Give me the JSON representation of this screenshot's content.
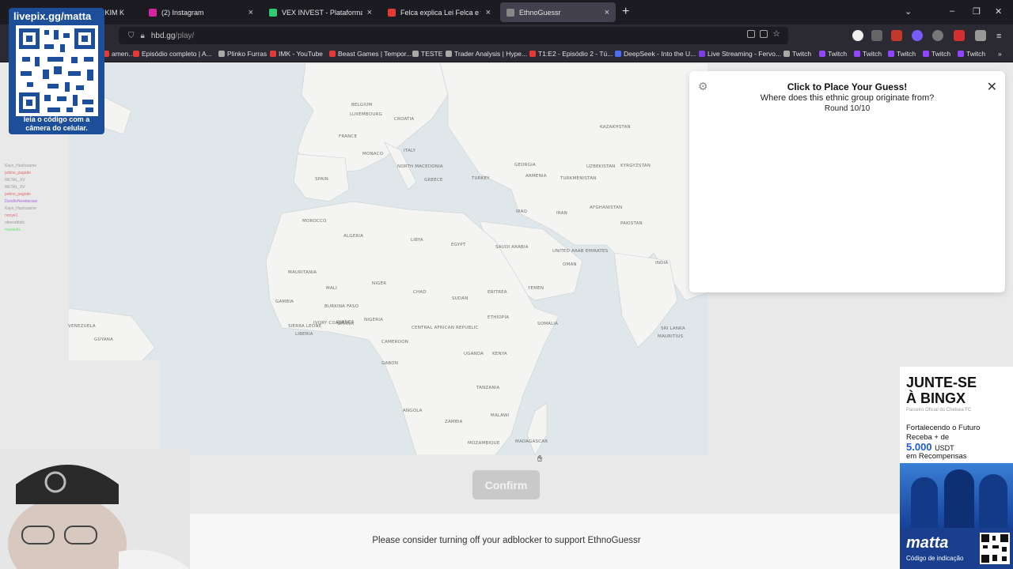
{
  "browser": {
    "tabs": [
      {
        "title": "E KIM K",
        "close": "×",
        "color": "#c0392b"
      },
      {
        "title": "(2) Instagram",
        "close": "×",
        "color": "#d6249f"
      },
      {
        "title": "VEX INVEST - Plataforma de Inv",
        "close": "×",
        "color": "#2ecc71"
      },
      {
        "title": "Felca explica Lei Felca e faz aler",
        "close": "×",
        "color": "#e53935"
      },
      {
        "title": "EthnoGuessr",
        "close": "×",
        "color": "#888888"
      }
    ],
    "new_tab": "+",
    "url_host": "hbd.gg",
    "url_path": "/play/",
    "bookmarks": [
      {
        "label": "amen...",
        "color": "#e53935"
      },
      {
        "label": "Episódio completo | A...",
        "color": "#e53935"
      },
      {
        "label": "Plinko Furras",
        "color": "#aaaaaa"
      },
      {
        "label": "IMK - YouTube",
        "color": "#e53935"
      },
      {
        "label": "Beast Games | Tempor...",
        "color": "#e53935"
      },
      {
        "label": "TESTE",
        "color": "#aaaaaa"
      },
      {
        "label": "Trader Analysis | Hype...",
        "color": "#aaaaaa"
      },
      {
        "label": "T1:E2 - Episódio 2 - Tú...",
        "color": "#e53935"
      },
      {
        "label": "DeepSeek - Into the U...",
        "color": "#4a6cf7"
      },
      {
        "label": "Live Streaming - Fervo...",
        "color": "#7b3fe4"
      },
      {
        "label": "Twitch",
        "color": "#aaaaaa"
      },
      {
        "label": "Twitch",
        "color": "#9146ff"
      },
      {
        "label": "Twitch",
        "color": "#9146ff"
      },
      {
        "label": "Twitch",
        "color": "#9146ff"
      },
      {
        "label": "Twitch",
        "color": "#9146ff"
      },
      {
        "label": "Twitch",
        "color": "#9146ff"
      }
    ]
  },
  "overlay": {
    "qr_header": "livepix.gg/matta",
    "qr_footer": "leia o código com a câmera do celular.",
    "chat": [
      "Kayn_Hashurame",
      "pokno_pagode",
      "METAL_XV",
      "METAL_XV",
      "pokno_pagode",
      "DoodleNewbaraan",
      "Kayn_Hashurame",
      "nnnye1",
      "otterrabbitv",
      "marisolix"
    ]
  },
  "map_labels": [
    {
      "text": "BELGIUM"
    },
    {
      "text": "LUXEMBOURG"
    },
    {
      "text": "FRANCE"
    },
    {
      "text": "MONACO"
    },
    {
      "text": "CROATIA"
    },
    {
      "text": "SPAIN"
    },
    {
      "text": "ITALY"
    },
    {
      "text": "NORTH MACEDONIA"
    },
    {
      "text": "GREECE"
    },
    {
      "text": "TURKEY"
    },
    {
      "text": "GEORGIA"
    },
    {
      "text": "ARMENIA"
    },
    {
      "text": "KAZAKHSTAN"
    },
    {
      "text": "UZBEKISTAN"
    },
    {
      "text": "KYRGYZSTAN"
    },
    {
      "text": "TURKMENISTAN"
    },
    {
      "text": "IRAQ"
    },
    {
      "text": "IRAN"
    },
    {
      "text": "AFGHANISTAN"
    },
    {
      "text": "PAKISTAN"
    },
    {
      "text": "MOROCCO"
    },
    {
      "text": "ALGERIA"
    },
    {
      "text": "LIBYA"
    },
    {
      "text": "EGYPT"
    },
    {
      "text": "SAUDI ARABIA"
    },
    {
      "text": "UNITED ARAB EMIRATES"
    },
    {
      "text": "OMAN"
    },
    {
      "text": "INDIA"
    },
    {
      "text": "MAURITANIA"
    },
    {
      "text": "MALI"
    },
    {
      "text": "NIGER"
    },
    {
      "text": "CHAD"
    },
    {
      "text": "SUDAN"
    },
    {
      "text": "ERITREA"
    },
    {
      "text": "YEMEN"
    },
    {
      "text": "GAMBIA"
    },
    {
      "text": "BURKINA FASO"
    },
    {
      "text": "GUINEA"
    },
    {
      "text": "NIGERIA"
    },
    {
      "text": "SIERRA LEONE"
    },
    {
      "text": "IVORY COAST"
    },
    {
      "text": "GHANA"
    },
    {
      "text": "LIBERIA"
    },
    {
      "text": "CENTRAL AFRICAN REPUBLIC"
    },
    {
      "text": "ETHIOPIA"
    },
    {
      "text": "SOMALIA"
    },
    {
      "text": "CAMEROON"
    },
    {
      "text": "GABON"
    },
    {
      "text": "UGANDA"
    },
    {
      "text": "KENYA"
    },
    {
      "text": "TANZANIA"
    },
    {
      "text": "ANGOLA"
    },
    {
      "text": "ZAMBIA"
    },
    {
      "text": "MALAWI"
    },
    {
      "text": "MOZAMBIQUE"
    },
    {
      "text": "MADAGASCAR"
    },
    {
      "text": "VENEZUELA"
    },
    {
      "text": "GUYANA"
    },
    {
      "text": "SRI LANKA"
    },
    {
      "text": "MAURITIUS"
    }
  ],
  "guess_panel": {
    "title": "Click to Place Your Guess!",
    "subtitle": "Where does this ethnic group originate from?",
    "round": "Round 10/10",
    "close_icon": "✕",
    "settings_icon": "⚙"
  },
  "confirm_label": "Confirm",
  "adblock_note": "Please consider turning off your adblocker to support EthnoGuessr",
  "ad": {
    "title_line1": "JUNTE-SE",
    "title_line2": "À BINGX",
    "partner": "Parceiro Oficial do Chelsea FC",
    "line1a": "Fortalecendo o Futuro",
    "line1b": "Receba + de",
    "amount": "5.000",
    "amount_unit": "USDT",
    "line3": "em Recompensas",
    "brand": "matta",
    "brand_code": "Código de indicação"
  }
}
